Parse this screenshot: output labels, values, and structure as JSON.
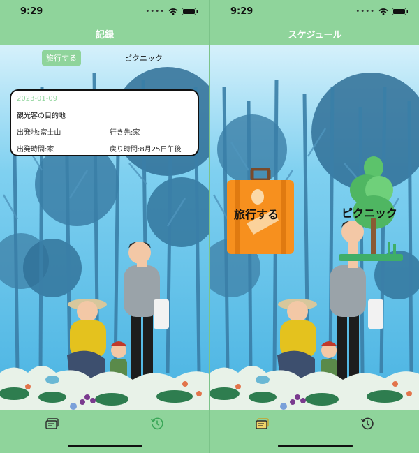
{
  "status": {
    "time": "9:29"
  },
  "record": {
    "title": "記録",
    "segments": [
      "旅行する",
      "ピクニック"
    ],
    "entry": {
      "date": "2023-01-09",
      "title": "観光客の目的地",
      "departure_place": "出発地:富士山",
      "destination": "行き先:家",
      "departure_time": "出発時間:家",
      "return_time": "戻り時間:8月25日午後"
    }
  },
  "schedule": {
    "title": "スケジュール",
    "categories": [
      {
        "label": "旅行する",
        "icon": "suitcase-icon"
      },
      {
        "label": "ピクニック",
        "icon": "tree-icon"
      }
    ]
  },
  "tabbar": {
    "items": [
      {
        "icon": "records-card-icon"
      },
      {
        "icon": "history-clock-icon"
      }
    ]
  },
  "colors": {
    "accent": "#8fd49b",
    "sky": "#59bde8",
    "tree_dark": "#2d6f93",
    "suitcase": "#f7901e"
  }
}
